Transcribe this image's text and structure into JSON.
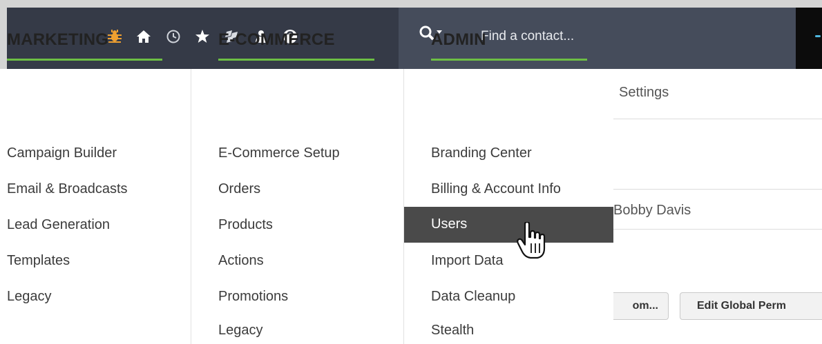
{
  "toolbar": {
    "icons": [
      "bug-icon",
      "home-icon",
      "clock-icon",
      "star-icon",
      "puzzle-icon",
      "person-icon",
      "help-icon"
    ]
  },
  "search": {
    "placeholder": "Find a contact..."
  },
  "background_page": {
    "settings_label": "Settings",
    "user_name": "Bobby Davis",
    "button1_label": "om...",
    "button2_label": "Edit Global Perm"
  },
  "menu": {
    "columns": [
      {
        "title": "MARKETING",
        "items": [
          "Campaign Builder",
          "Email & Broadcasts",
          "Lead Generation",
          "Templates",
          "Legacy"
        ]
      },
      {
        "title": "E-COMMERCE",
        "items": [
          "E-Commerce Setup",
          "Orders",
          "Products",
          "Actions",
          "Promotions",
          "Legacy"
        ]
      },
      {
        "title": "ADMIN",
        "items": [
          "Branding Center",
          "Billing & Account Info",
          "Users",
          "Import Data",
          "Data Cleanup",
          "Stealth"
        ]
      }
    ],
    "highlighted_item": "Users"
  },
  "colors": {
    "topbar_icons": "#f0a030",
    "accent_underline": "#6dbf44",
    "highlight_bg": "#4a4a4a"
  }
}
